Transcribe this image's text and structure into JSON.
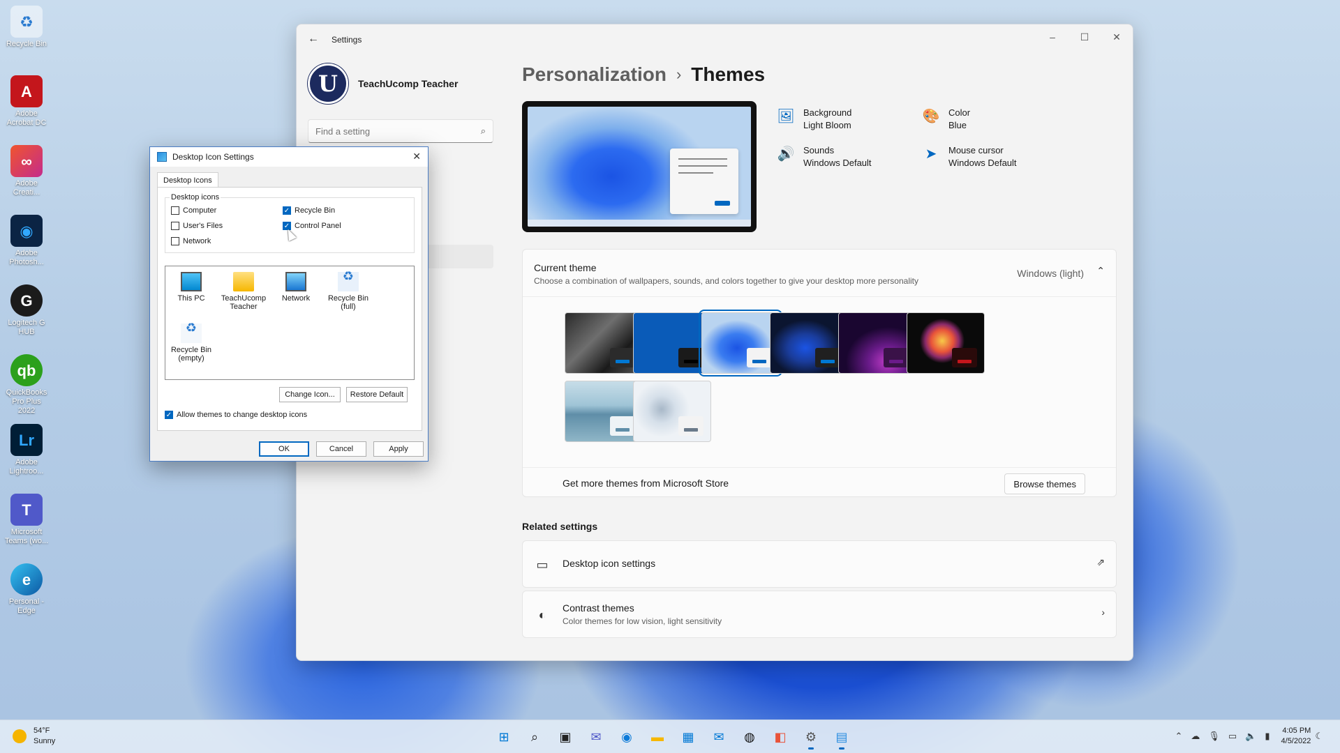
{
  "desktop": {
    "icons": [
      {
        "label": "Recycle Bin",
        "icon": "recycle-bin-icon"
      },
      {
        "label": "Adobe Acrobat DC",
        "icon": "acrobat-icon"
      },
      {
        "label": "Adobe Creati...",
        "icon": "creative-cloud-icon"
      },
      {
        "label": "Adobe Photosh...",
        "icon": "photoshop-icon"
      },
      {
        "label": "Logitech G HUB",
        "icon": "logitech-icon"
      },
      {
        "label": "QuickBooks Pro Plus 2022",
        "icon": "quickbooks-icon"
      },
      {
        "label": "Adobe Lightroo...",
        "icon": "lightroom-icon"
      },
      {
        "label": "Microsoft Teams (wo...",
        "icon": "teams-icon"
      },
      {
        "label": "Personal - Edge",
        "icon": "edge-icon"
      }
    ]
  },
  "settings": {
    "title": "Settings",
    "user": {
      "avatar_letter": "U",
      "name": "TeachUcomp Teacher"
    },
    "search": {
      "placeholder": "Find a setting"
    },
    "breadcrumb": {
      "parent": "Personalization",
      "separator": "›",
      "current": "Themes"
    },
    "properties": {
      "background": {
        "name": "Background",
        "value": "Light Bloom"
      },
      "color": {
        "name": "Color",
        "value": "Blue"
      },
      "sounds": {
        "name": "Sounds",
        "value": "Windows Default"
      },
      "cursor": {
        "name": "Mouse cursor",
        "value": "Windows Default"
      }
    },
    "current_theme": {
      "title": "Current theme",
      "subtitle": "Choose a combination of wallpapers, sounds, and colors together to give your desktop more personality",
      "value": "Windows (light)"
    },
    "store": {
      "text": "Get more themes from Microsoft Store",
      "button": "Browse themes"
    },
    "related": {
      "title": "Related settings",
      "desktop_icons": {
        "label": "Desktop icon settings"
      },
      "contrast": {
        "label": "Contrast themes",
        "sub": "Color themes for low vision, light sensitivity"
      }
    }
  },
  "dialog": {
    "title": "Desktop Icon Settings",
    "tab": "Desktop Icons",
    "group_label": "Desktop icons",
    "checkboxes": {
      "computer": {
        "label": "Computer",
        "checked": false
      },
      "users_files": {
        "label": "User's Files",
        "checked": false
      },
      "network": {
        "label": "Network",
        "checked": false
      },
      "recycle_bin": {
        "label": "Recycle Bin",
        "checked": true
      },
      "control_panel": {
        "label": "Control Panel",
        "checked": true
      }
    },
    "icons": {
      "this_pc": "This PC",
      "teacher": "TeachUcomp Teacher",
      "network": "Network",
      "bin_full": "Recycle Bin (full)",
      "bin_empty": "Recycle Bin (empty)"
    },
    "change_icon": "Change Icon...",
    "restore_default": "Restore Default",
    "allow_themes": {
      "label": "Allow themes to change desktop icons",
      "checked": true
    },
    "ok": "OK",
    "cancel": "Cancel",
    "apply": "Apply"
  },
  "taskbar": {
    "weather": {
      "temp": "54°F",
      "condition": "Sunny"
    },
    "clock": {
      "time": "4:05 PM",
      "date": "4/5/2022"
    }
  },
  "colors": {
    "accent": "#0067c0",
    "avatar": "#1c2a5e"
  }
}
